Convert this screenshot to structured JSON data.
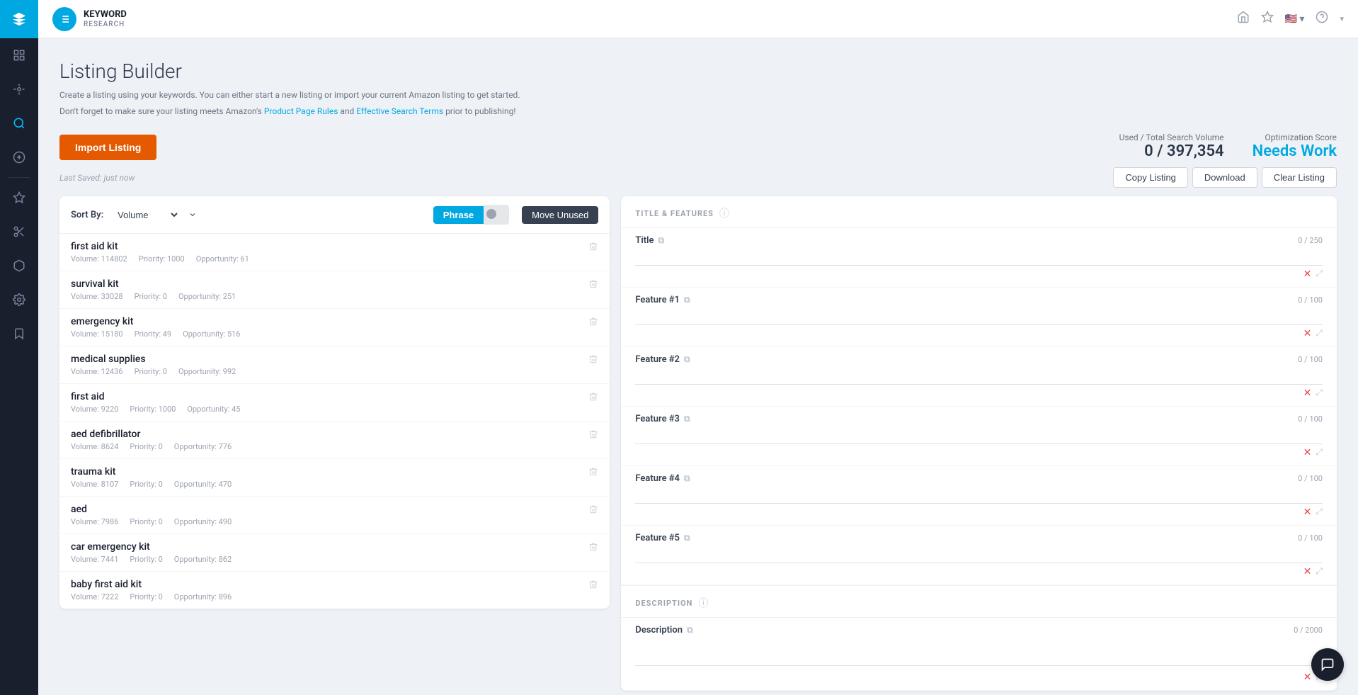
{
  "brand": {
    "name": "KEYWORD",
    "sub": "RESEARCH"
  },
  "page": {
    "title": "Listing Builder",
    "description_line1": "Create a listing using your keywords. You can either start a new listing or import your current Amazon listing to get started.",
    "description_line2": "Don't forget to make sure your listing meets Amazon's",
    "link1": "Product Page Rules",
    "link2": "Effective Search Terms",
    "description_suffix": "prior to publishing!",
    "last_saved": "Last Saved: just now"
  },
  "stats": {
    "used_total_label": "Used / Total Search Volume",
    "used_value": "0 / 397,354",
    "opt_label": "Optimization Score",
    "opt_value": "Needs Work"
  },
  "buttons": {
    "import": "Import Listing",
    "copy": "Copy Listing",
    "download": "Download",
    "clear": "Clear Listing",
    "phrase": "Phrase",
    "move_unused": "Move Unused"
  },
  "sort": {
    "label": "Sort By:",
    "value": "Volume"
  },
  "keywords": [
    {
      "name": "first aid kit",
      "volume": "114802",
      "priority": "1000",
      "opportunity": "61"
    },
    {
      "name": "survival kit",
      "volume": "33028",
      "priority": "0",
      "opportunity": "251"
    },
    {
      "name": "emergency kit",
      "volume": "15180",
      "priority": "49",
      "opportunity": "516"
    },
    {
      "name": "medical supplies",
      "volume": "12436",
      "priority": "0",
      "opportunity": "992"
    },
    {
      "name": "first aid",
      "volume": "9220",
      "priority": "1000",
      "opportunity": "45"
    },
    {
      "name": "aed defibrillator",
      "volume": "8624",
      "priority": "0",
      "opportunity": "776"
    },
    {
      "name": "trauma kit",
      "volume": "8107",
      "priority": "0",
      "opportunity": "470"
    },
    {
      "name": "aed",
      "volume": "7986",
      "priority": "0",
      "opportunity": "490"
    },
    {
      "name": "car emergency kit",
      "volume": "7441",
      "priority": "0",
      "opportunity": "862"
    },
    {
      "name": "baby first aid kit",
      "volume": "7222",
      "priority": "0",
      "opportunity": "896"
    }
  ],
  "fields": {
    "title": {
      "label": "Title",
      "counter": "0 / 250",
      "value": ""
    },
    "feature1": {
      "label": "Feature #1",
      "counter": "0 / 100",
      "value": ""
    },
    "feature2": {
      "label": "Feature #2",
      "counter": "0 / 100",
      "value": ""
    },
    "feature3": {
      "label": "Feature #3",
      "counter": "0 / 100",
      "value": ""
    },
    "feature4": {
      "label": "Feature #4",
      "counter": "0 / 100",
      "value": ""
    },
    "feature5": {
      "label": "Feature #5",
      "counter": "0 / 100",
      "value": ""
    },
    "description": {
      "label": "Description",
      "counter": "0 / 2000",
      "value": ""
    }
  },
  "sections": {
    "title_features": "TITLE & FEATURES",
    "description": "DESCRIPTION"
  },
  "nav_items": [
    {
      "icon": "⊞",
      "name": "dashboard"
    },
    {
      "icon": "✦",
      "name": "keywords"
    },
    {
      "icon": "🔍",
      "name": "search"
    },
    {
      "icon": "🚀",
      "name": "launch"
    },
    {
      "icon": "📌",
      "name": "pin"
    },
    {
      "icon": "✂",
      "name": "cut"
    },
    {
      "icon": "📦",
      "name": "box"
    },
    {
      "icon": "⚙",
      "name": "settings"
    },
    {
      "icon": "🔖",
      "name": "bookmark"
    }
  ]
}
